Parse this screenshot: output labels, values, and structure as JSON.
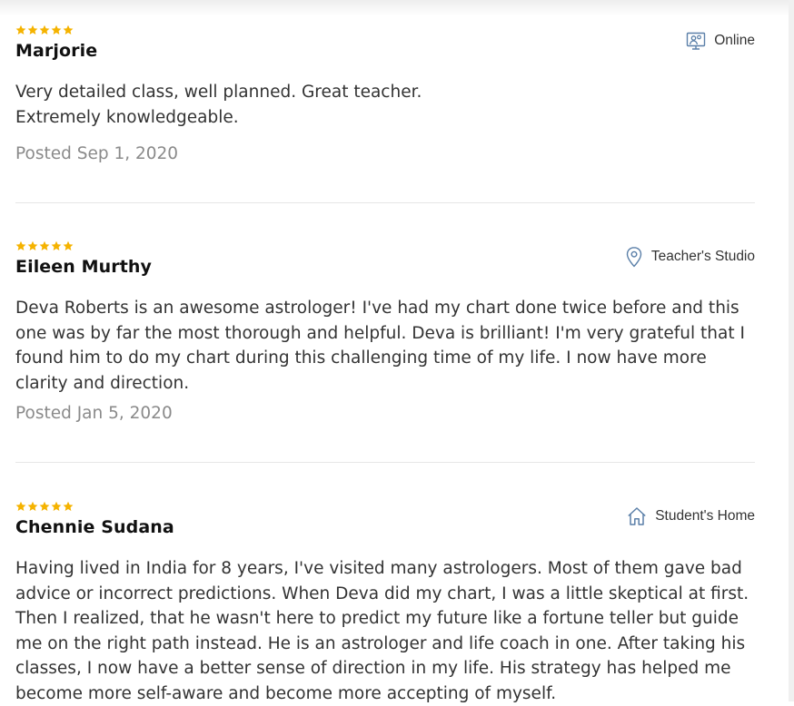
{
  "colors": {
    "star": "#f5b300",
    "posted": "#8a8a8a",
    "icon": "#5a7fa8"
  },
  "reviews": [
    {
      "rating": 5,
      "name": "Marjorie",
      "location": "Online",
      "location_icon": "online-class-icon",
      "text": "Very detailed class, well planned. Great teacher.\nExtremely knowledgeable.",
      "posted": "Posted Sep 1, 2020"
    },
    {
      "rating": 5,
      "name": "Eileen Murthy",
      "location": "Teacher's Studio",
      "location_icon": "map-pin-icon",
      "text": "Deva Roberts is an awesome astrologer! I've had my chart done twice before and this one was by far the most thorough and helpful. Deva is brilliant! I'm very grateful that I found him to do my chart during this challenging time of my life. I now have more clarity and direction.",
      "posted": "Posted Jan 5, 2020"
    },
    {
      "rating": 5,
      "name": "Chennie Sudana",
      "location": "Student's Home",
      "location_icon": "home-icon",
      "text": "Having lived in India for 8 years, I've visited many astrologers. Most of them gave bad advice or incorrect predictions. When Deva did my chart, I was a little skeptical at first. Then I realized, that he wasn't here to predict my future like a fortune teller but guide me on the right path instead. He is an astrologer and life coach in one. After taking his classes, I now have a better sense of direction in my life. His strategy has helped me become more self-aware and become more accepting of myself.",
      "posted": ""
    }
  ]
}
